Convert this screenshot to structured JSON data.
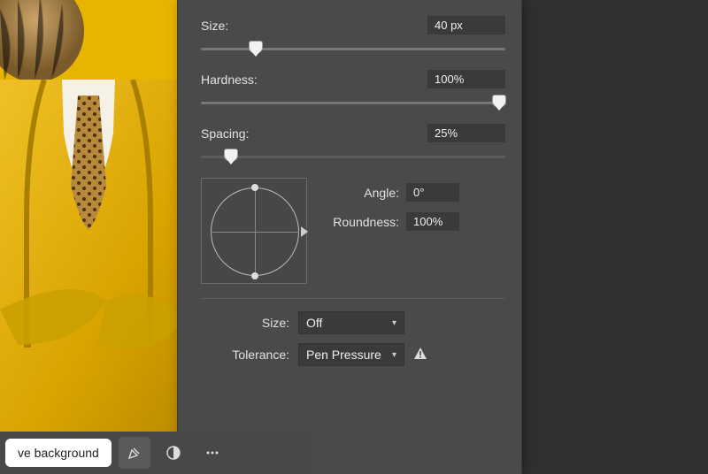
{
  "panel": {
    "size": {
      "label": "Size:",
      "value": "40 px",
      "percent": 18
    },
    "hardness": {
      "label": "Hardness:",
      "value": "100%",
      "percent": 98
    },
    "spacing": {
      "label": "Spacing:",
      "value": "25%",
      "percent": 10
    },
    "angle": {
      "label": "Angle:",
      "value": "0°"
    },
    "roundness": {
      "label": "Roundness:",
      "value": "100%"
    },
    "dynamics": {
      "size": {
        "label": "Size:",
        "selected": "Off"
      },
      "tolerance": {
        "label": "Tolerance:",
        "selected": "Pen Pressure"
      }
    }
  },
  "toolbar": {
    "remove_bg": "ve background"
  }
}
